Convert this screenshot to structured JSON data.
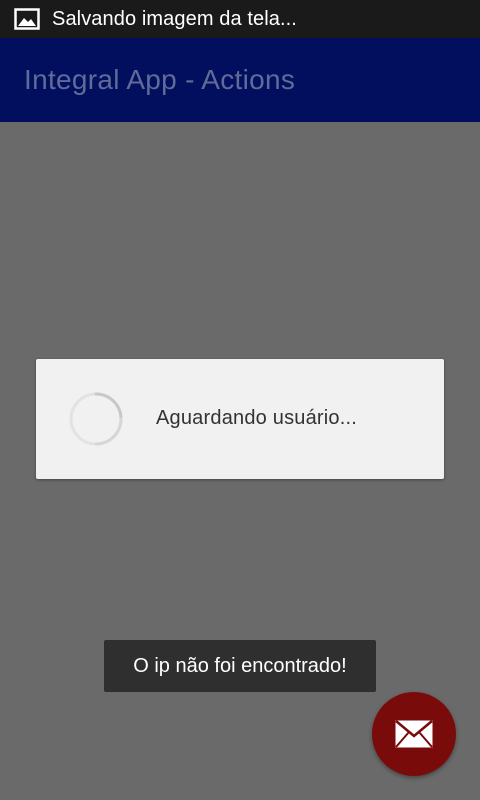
{
  "status_bar": {
    "notification_icon": "image-icon",
    "text": "Salvando imagem da tela..."
  },
  "action_bar": {
    "title": "Integral App - Actions",
    "color": "#020f5e"
  },
  "dialog": {
    "message": "Aguardando usuário...",
    "indicator": "progress-spinner-icon"
  },
  "toast": {
    "message": "O ip não foi encontrado!"
  },
  "fab": {
    "icon": "envelope-icon",
    "color": "#7a0b0b"
  },
  "colors": {
    "background_dim": "#6a6a6a",
    "dialog_bg": "#f1f1f1",
    "toast_bg": "#2f2f2f"
  }
}
